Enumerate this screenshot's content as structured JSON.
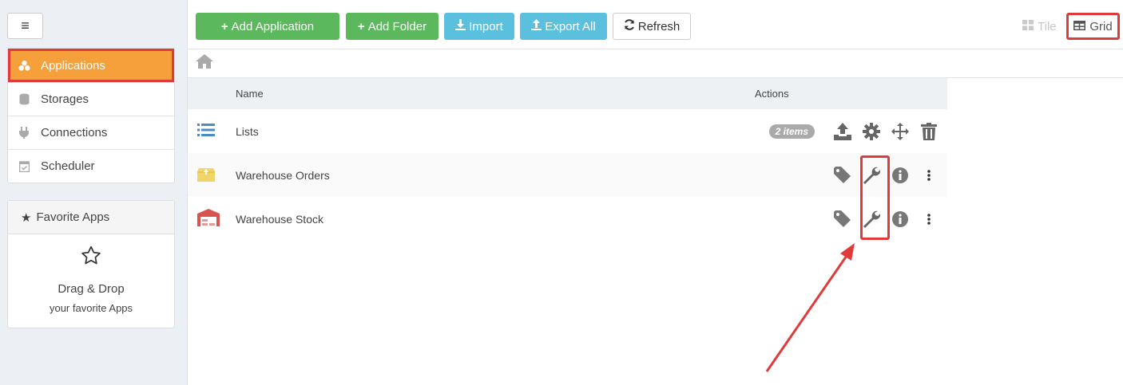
{
  "sidebar": {
    "nav": [
      {
        "label": "Applications",
        "icon": "cubes-icon",
        "active": true
      },
      {
        "label": "Storages",
        "icon": "database-icon"
      },
      {
        "label": "Connections",
        "icon": "plug-icon"
      },
      {
        "label": "Scheduler",
        "icon": "calendar-check-icon"
      }
    ],
    "favorites": {
      "title": "Favorite Apps",
      "drag_text": "Drag & Drop",
      "sub_text": "your favorite Apps"
    }
  },
  "toolbar": {
    "add_application": "Add Application",
    "add_folder": "Add Folder",
    "import": "Import",
    "export_all": "Export All",
    "refresh": "Refresh",
    "tile": "Tile",
    "grid": "Grid"
  },
  "table": {
    "headers": {
      "name": "Name",
      "actions": "Actions"
    },
    "rows": [
      {
        "name": "Lists",
        "icon": "list-icon",
        "badge": "2 items"
      },
      {
        "name": "Warehouse Orders",
        "icon": "box-icon"
      },
      {
        "name": "Warehouse Stock",
        "icon": "warehouse-icon"
      }
    ]
  },
  "colors": {
    "active_nav": "#f5a03a",
    "highlight": "#e03a3a",
    "green_button": "#5cb85c",
    "blue_button": "#5bc0de"
  }
}
